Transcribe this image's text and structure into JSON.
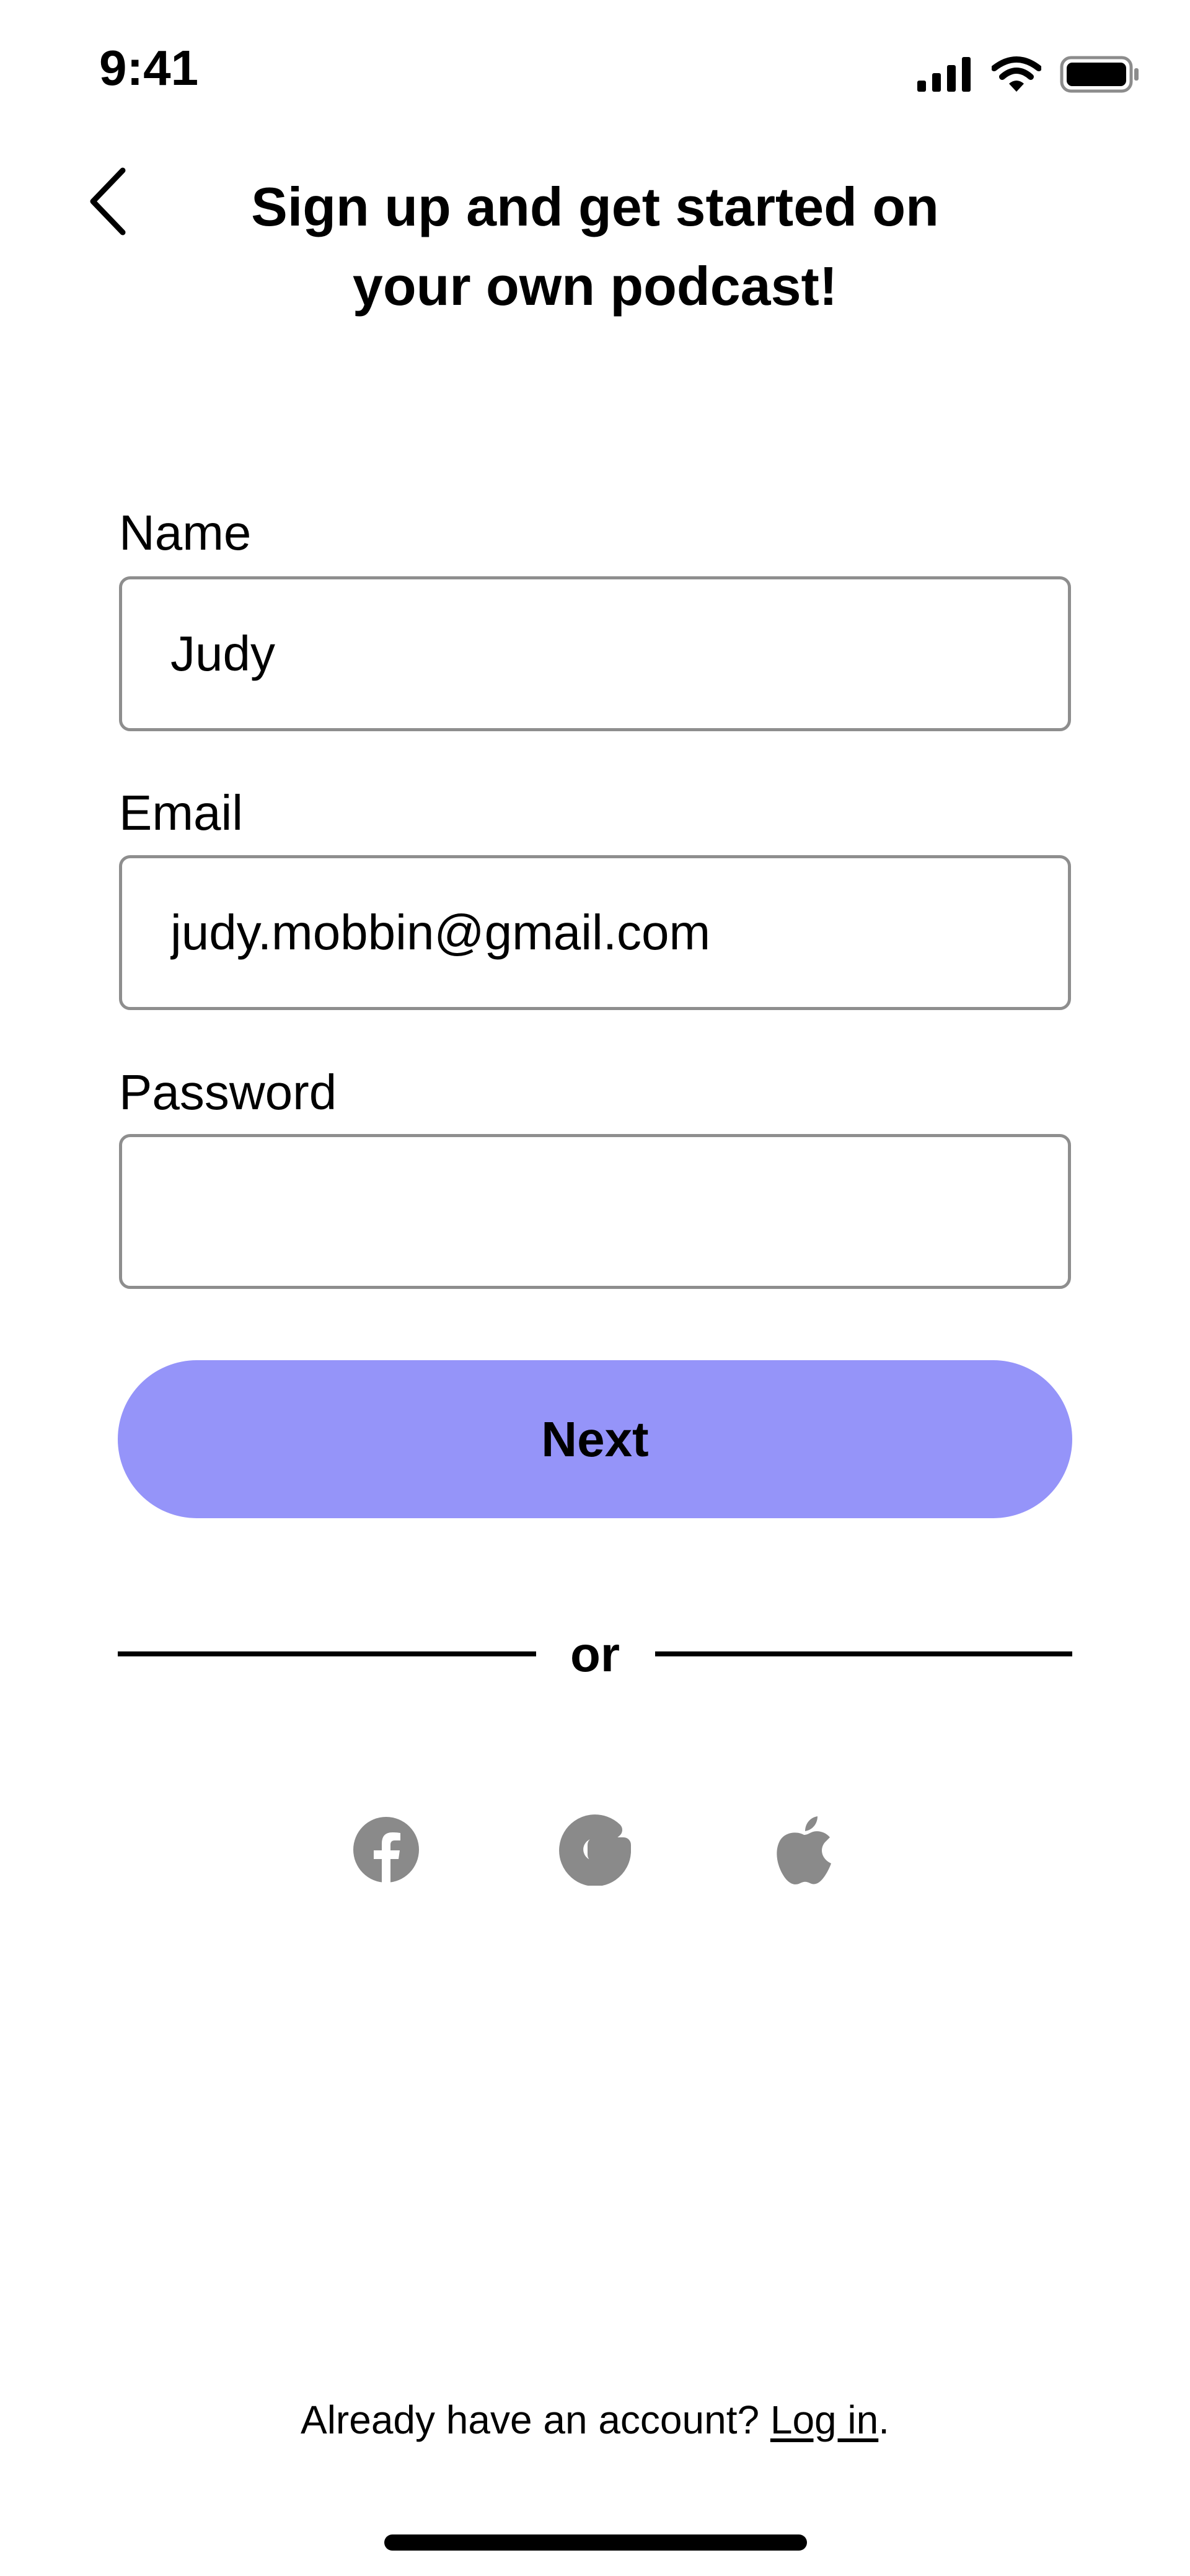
{
  "status_bar": {
    "time": "9:41"
  },
  "header": {
    "title": "Sign up and get started on your own podcast!"
  },
  "form": {
    "name": {
      "label": "Name",
      "value": "Judy"
    },
    "email": {
      "label": "Email",
      "value": "judy.mobbin@gmail.com"
    },
    "password": {
      "label": "Password",
      "value": ""
    },
    "next_label": "Next"
  },
  "divider": {
    "text": "or"
  },
  "social": {
    "items": [
      "facebook-icon",
      "google-icon",
      "apple-icon"
    ],
    "icon_color": "#8a8a8a"
  },
  "footer": {
    "prompt": "Already have an account? ",
    "link_label": "Log in",
    "suffix": "."
  },
  "colors": {
    "accent": "#9594f9",
    "input_border": "#8e8e8e"
  }
}
